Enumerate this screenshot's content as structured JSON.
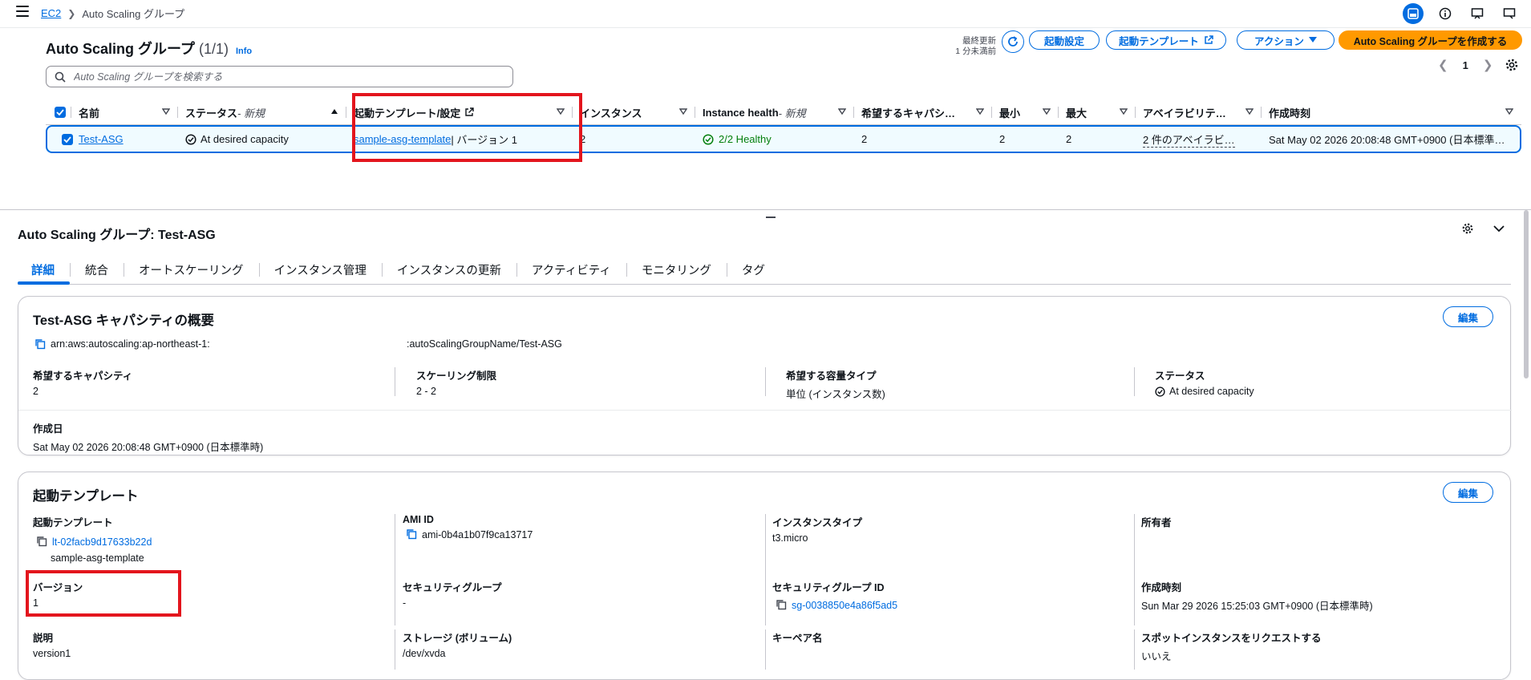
{
  "breadcrumb": {
    "root": "EC2",
    "current": "Auto Scaling グループ"
  },
  "header": {
    "title": "Auto Scaling グループ",
    "count": "(1/1)",
    "info": "Info",
    "last_updated_label": "最終更新",
    "last_updated_value": "1 分未満前",
    "buttons": {
      "launch_config": "起動設定",
      "launch_templates": "起動テンプレート",
      "actions": "アクション",
      "create": "Auto Scaling グループを作成する"
    },
    "search_placeholder": "Auto Scaling グループを検索する",
    "page_number": "1"
  },
  "table": {
    "columns": {
      "name": "名前",
      "status": "ステータス",
      "status_suffix": " - 新規",
      "launch_template": "起動テンプレート/設定",
      "instances": "インスタンス",
      "health": "Instance health",
      "health_suffix": " - 新規",
      "desired": "希望するキャパシ…",
      "min": "最小",
      "max": "最大",
      "az": "アベイラビリテ…",
      "created": "作成時刻"
    },
    "row": {
      "name": "Test-ASG",
      "status": "At desired capacity",
      "template_link": "sample-asg-template",
      "template_version": " | バージョン 1",
      "instances": "2",
      "health": "2/2 Healthy",
      "desired": "2",
      "min": "2",
      "max": "2",
      "az": "2 件のアベイラビ…",
      "created": "Sat May 02 2026 20:08:48 GMT+0900 (日本標準…"
    }
  },
  "details": {
    "title": "Auto Scaling グループ: Test-ASG",
    "tabs": [
      "詳細",
      "統合",
      "オートスケーリング",
      "インスタンス管理",
      "インスタンスの更新",
      "アクティビティ",
      "モニタリング",
      "タグ"
    ],
    "capacity": {
      "title": "Test-ASG キャパシティの概要",
      "edit": "編集",
      "arn_prefix": "arn:aws:autoscaling:ap-northeast-1:",
      "arn_suffix": ":autoScalingGroupName/Test-ASG",
      "desired_label": "希望するキャパシティ",
      "desired_value": "2",
      "limits_label": "スケーリング制限",
      "limits_value": "2 - 2",
      "type_label": "希望する容量タイプ",
      "type_value": "単位 (インスタンス数)",
      "status_label": "ステータス",
      "status_value": "At desired capacity",
      "created_label": "作成日",
      "created_value": "Sat May 02 2026 20:08:48 GMT+0900 (日本標準時)"
    },
    "launch_template": {
      "title": "起動テンプレート",
      "edit": "編集",
      "lt_label": "起動テンプレート",
      "lt_id": "lt-02facb9d17633b22d",
      "lt_name": "sample-asg-template",
      "ami_label": "AMI ID",
      "ami_value": "ami-0b4a1b07f9ca13717",
      "itype_label": "インスタンスタイプ",
      "itype_value": "t3.micro",
      "owner_label": "所有者",
      "version_label": "バージョン",
      "version_value": "1",
      "sg_label": "セキュリティグループ",
      "sg_value": "-",
      "sgid_label": "セキュリティグループ ID",
      "sgid_value": "sg-0038850e4a86f5ad5",
      "created_label": "作成時刻",
      "created_value": "Sun Mar 29 2026 15:25:03 GMT+0900 (日本標準時)",
      "desc_label": "説明",
      "desc_value": "version1",
      "storage_label": "ストレージ (ボリューム)",
      "storage_value": "/dev/xvda",
      "keypair_label": "キーペア名",
      "spot_label": "スポットインスタンスをリクエストする",
      "spot_value": "いいえ"
    }
  },
  "colors": {
    "link": "#006ce0",
    "primary": "#ff9900",
    "healthy": "#037f0c",
    "highlight": "#e3151d"
  }
}
